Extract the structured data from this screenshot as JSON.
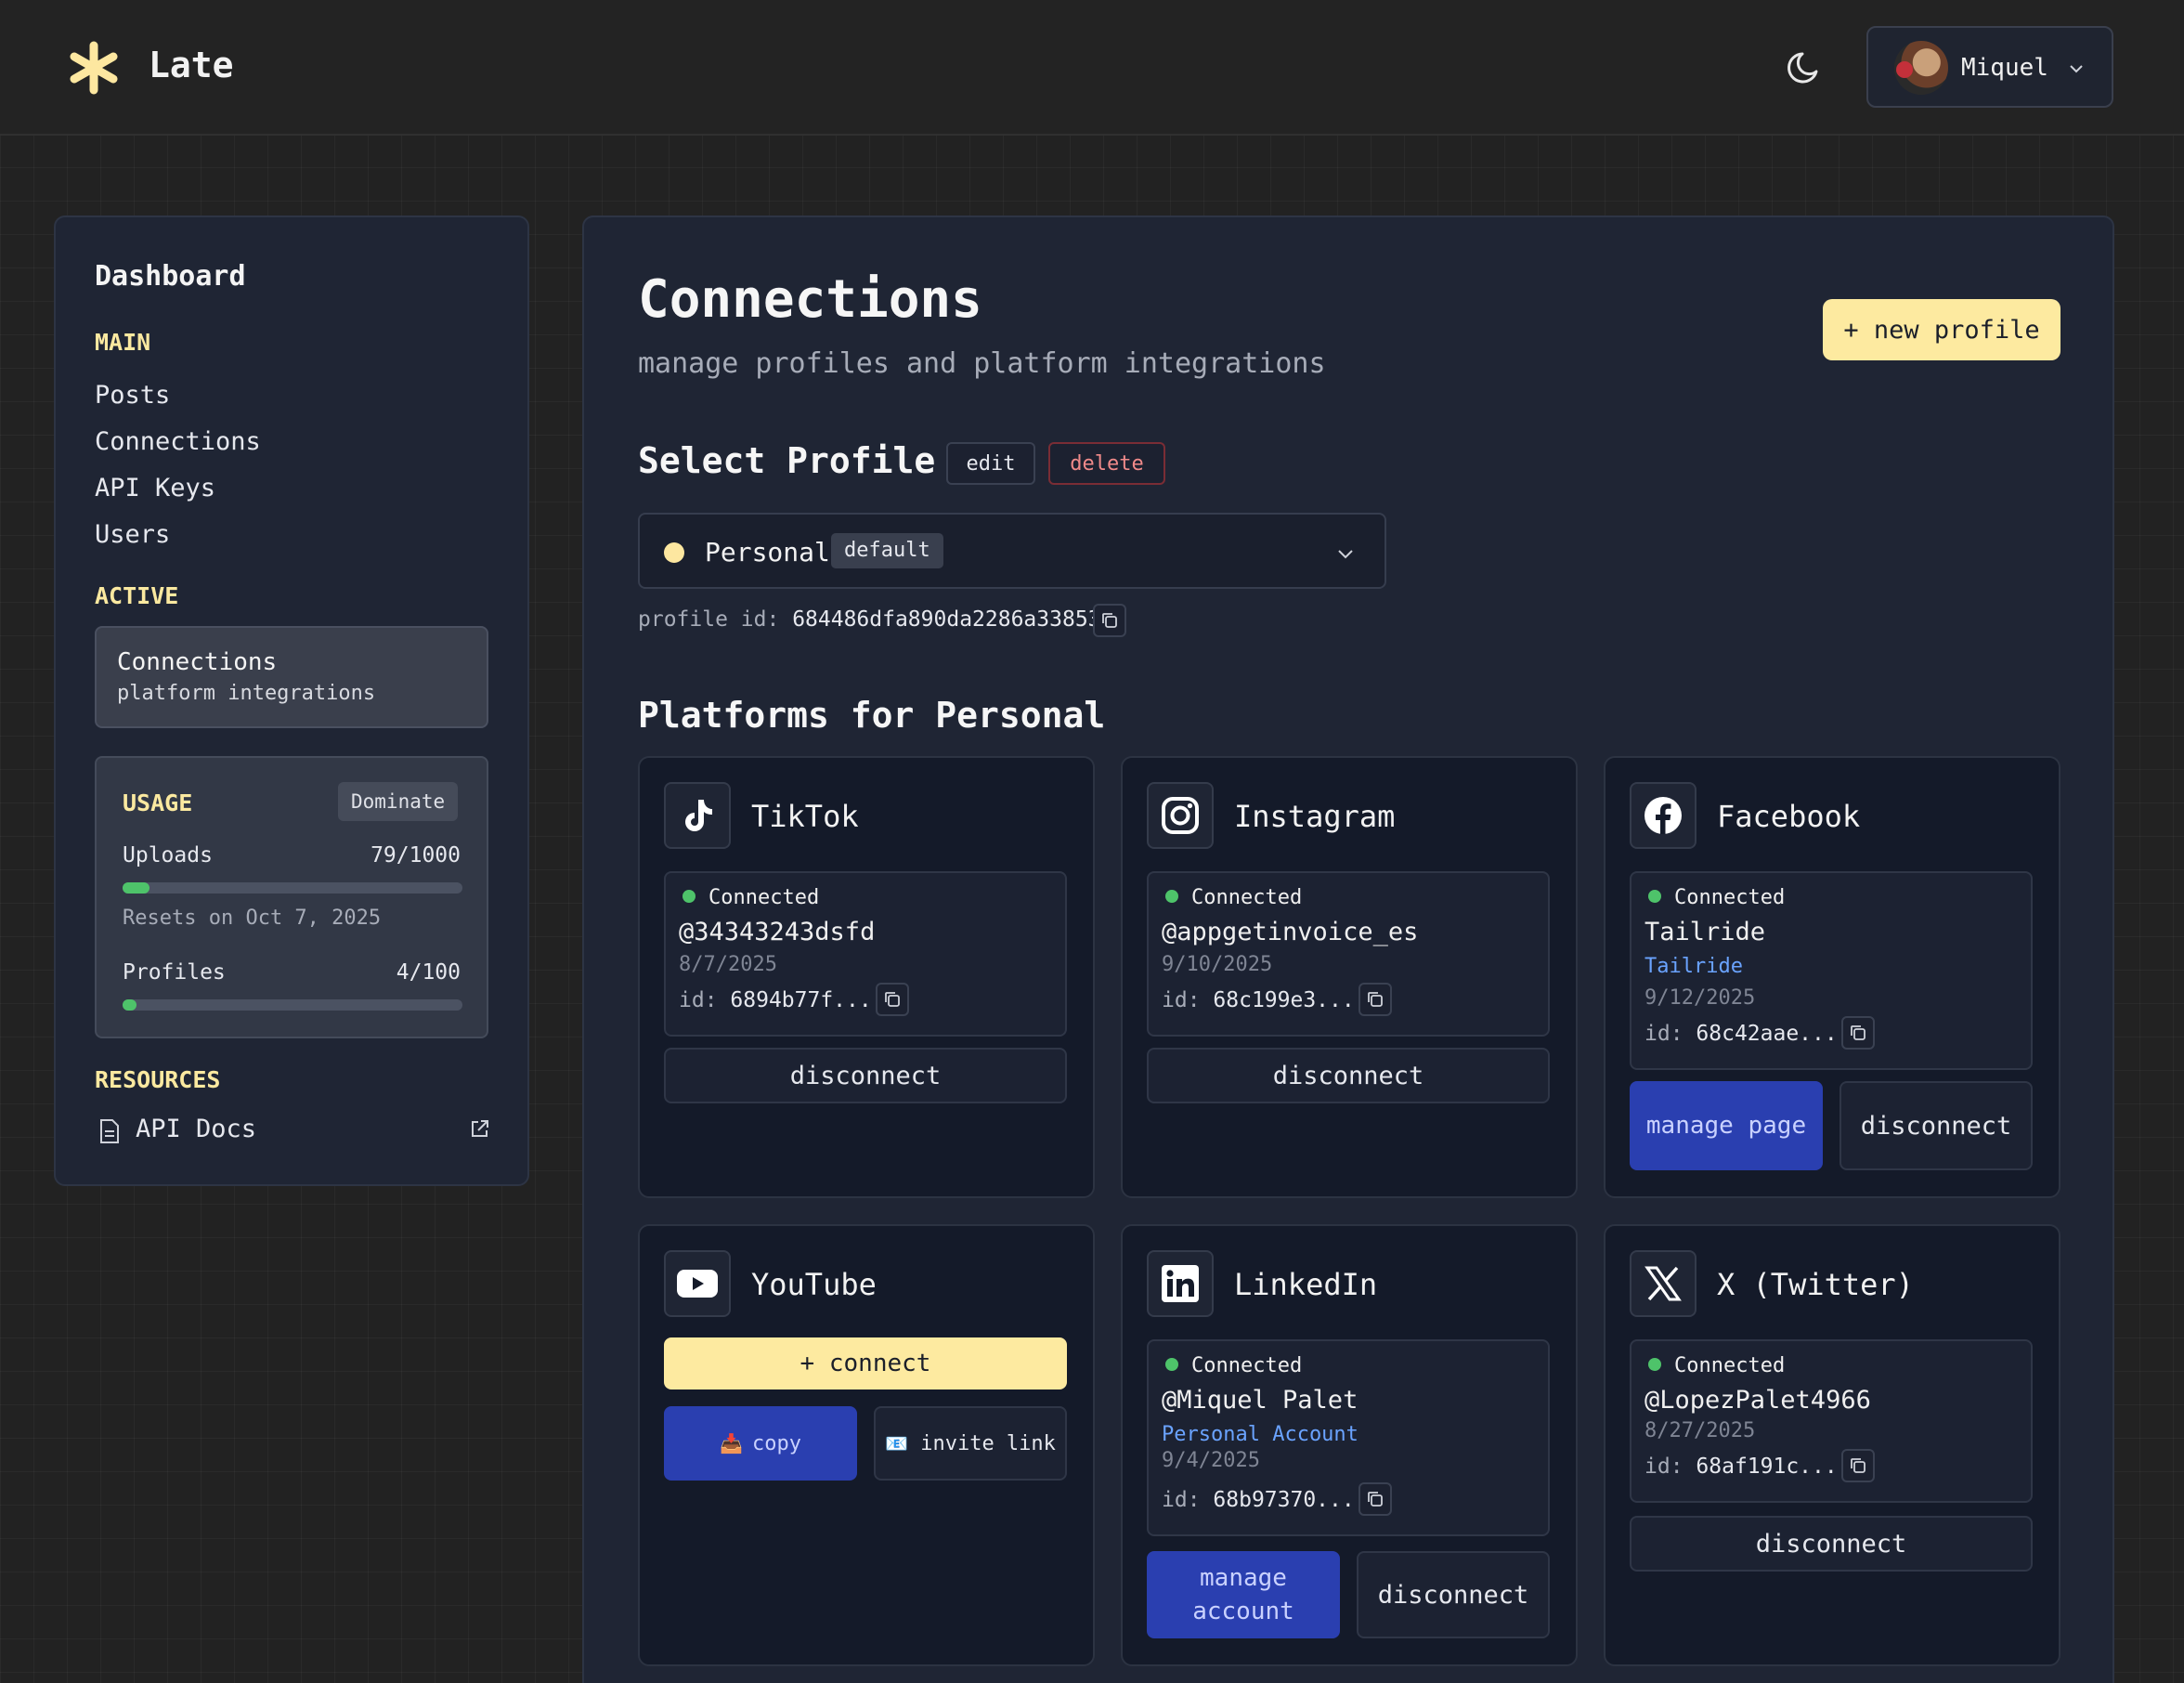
{
  "app": {
    "name": "Late"
  },
  "user": {
    "name": "Miquel"
  },
  "sidebar": {
    "title": "Dashboard",
    "main_label": "MAIN",
    "items": [
      "Posts",
      "Connections",
      "API Keys",
      "Users"
    ],
    "active_label": "ACTIVE",
    "active": {
      "title": "Connections",
      "subtitle": "platform integrations"
    },
    "usage": {
      "label": "USAGE",
      "plan": "Dominate",
      "uploads_label": "Uploads",
      "uploads_value": "79/1000",
      "uploads_fraction": 0.079,
      "resets": "Resets on Oct 7, 2025",
      "profiles_label": "Profiles",
      "profiles_value": "4/100",
      "profiles_fraction": 0.04
    },
    "resources_label": "RESOURCES",
    "api_docs": "API Docs"
  },
  "main": {
    "title": "Connections",
    "subtitle": "manage profiles and platform integrations",
    "new_profile": "+ new profile",
    "select_profile": "Select Profile",
    "edit": "edit",
    "delete": "delete",
    "profile": {
      "name": "Personal",
      "badge": "default"
    },
    "profile_id_label": "profile id:",
    "profile_id": "684486dfa890da2286a33853",
    "platforms_title": "Platforms for Personal"
  },
  "platforms": {
    "tiktok": {
      "name": "TikTok",
      "status": "Connected",
      "handle": "@34343243dsfd",
      "date": "8/7/2025",
      "id_label": "id:",
      "id": "6894b77f...",
      "disconnect": "disconnect"
    },
    "instagram": {
      "name": "Instagram",
      "status": "Connected",
      "handle": "@appgetinvoice_es",
      "date": "9/10/2025",
      "id_label": "id:",
      "id": "68c199e3...",
      "disconnect": "disconnect"
    },
    "facebook": {
      "name": "Facebook",
      "status": "Connected",
      "handle": "Tailride",
      "link": "Tailride",
      "date": "9/12/2025",
      "id_label": "id:",
      "id": "68c42aae...",
      "manage": "manage page",
      "disconnect": "disconnect"
    },
    "youtube": {
      "name": "YouTube",
      "connect": "+ connect",
      "copy": "copy",
      "invite": "invite link"
    },
    "linkedin": {
      "name": "LinkedIn",
      "status": "Connected",
      "handle": "@Miquel Palet",
      "link": "Personal Account",
      "date": "9/4/2025",
      "id_label": "id:",
      "id": "68b97370...",
      "manage": "manage account",
      "disconnect": "disconnect"
    },
    "twitter": {
      "name": "X (Twitter)",
      "status": "Connected",
      "handle": "@LopezPalet4966",
      "date": "8/27/2025",
      "id_label": "id:",
      "id": "68af191c...",
      "disconnect": "disconnect"
    }
  },
  "colors": {
    "accent": "#fdeaa0",
    "primary_button": "#2a3fb0",
    "connected": "#4ec36a",
    "danger": "#f08a8a"
  }
}
